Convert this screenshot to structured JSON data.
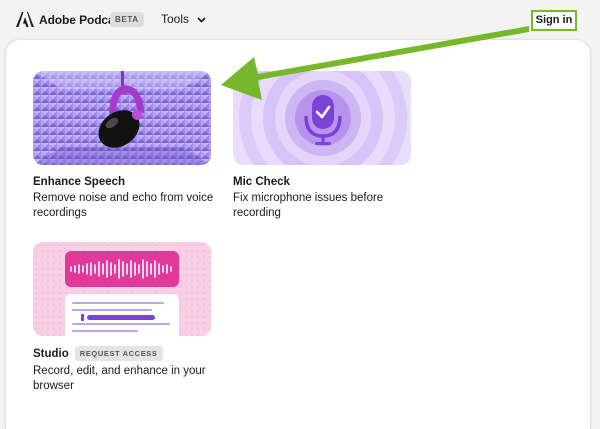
{
  "header": {
    "brand": "Adobe Podcast",
    "badge": "BETA",
    "tools_label": "Tools",
    "signin_label": "Sign in"
  },
  "cards": [
    {
      "title": "Enhance Speech",
      "description": "Remove noise and echo from voice recordings",
      "image_icon": "microphone-icon"
    },
    {
      "title": "Mic Check",
      "description": "Fix microphone issues before recording",
      "image_icon": "mic-check-icon"
    },
    {
      "title": "Studio",
      "badge": "REQUEST ACCESS",
      "description": "Record, edit, and enhance in your browser",
      "image_icon": "waveform-editor-icon"
    }
  ],
  "annotation": {
    "arrow_color": "#77b82a",
    "highlight_color": "#77b82a"
  },
  "colors": {
    "accent_purple": "#7b42d8",
    "studio_pink": "#e0399a"
  }
}
